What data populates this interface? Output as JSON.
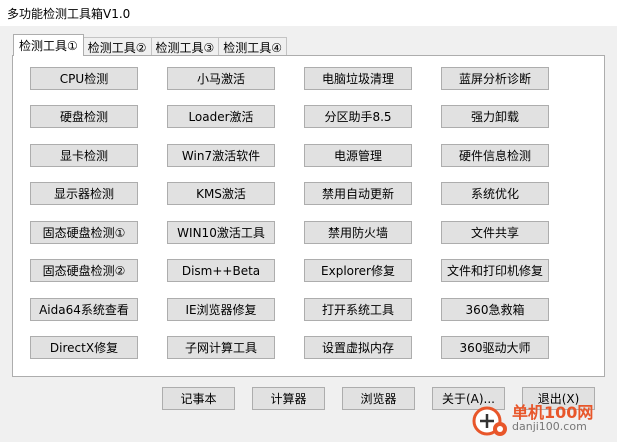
{
  "window": {
    "title": "多功能检测工具箱V1.0"
  },
  "tabs": [
    {
      "label": "检测工具①",
      "active": true
    },
    {
      "label": "检测工具②",
      "active": false
    },
    {
      "label": "检测工具③",
      "active": false
    },
    {
      "label": "检测工具④",
      "active": false
    }
  ],
  "grid": {
    "rows": [
      [
        "CPU检测",
        "小马激活",
        "电脑垃圾清理",
        "蓝屏分析诊断"
      ],
      [
        "硬盘检测",
        "Loader激活",
        "分区助手8.5",
        "强力卸载"
      ],
      [
        "显卡检测",
        "Win7激活软件",
        "电源管理",
        "硬件信息检测"
      ],
      [
        "显示器检测",
        "KMS激活",
        "禁用自动更新",
        "系统优化"
      ],
      [
        "固态硬盘检测①",
        "WIN10激活工具",
        "禁用防火墙",
        "文件共享"
      ],
      [
        "固态硬盘检测②",
        "Dism++Beta",
        "Explorer修复",
        "文件和打印机修复"
      ],
      [
        "Aida64系统查看",
        "IE浏览器修复",
        "打开系统工具",
        "360急救箱"
      ],
      [
        "DirectX修复",
        "子网计算工具",
        "设置虚拟内存",
        "360驱动大师"
      ]
    ]
  },
  "bottom_buttons": [
    "记事本",
    "计算器",
    "浏览器",
    "关于(A)...",
    "退出(X)"
  ],
  "watermark": {
    "main": "单机100网",
    "sub": "danji100.com"
  },
  "colors": {
    "watermark": "#e8562a",
    "button": "#e1e1e1",
    "border": "#adadad"
  }
}
